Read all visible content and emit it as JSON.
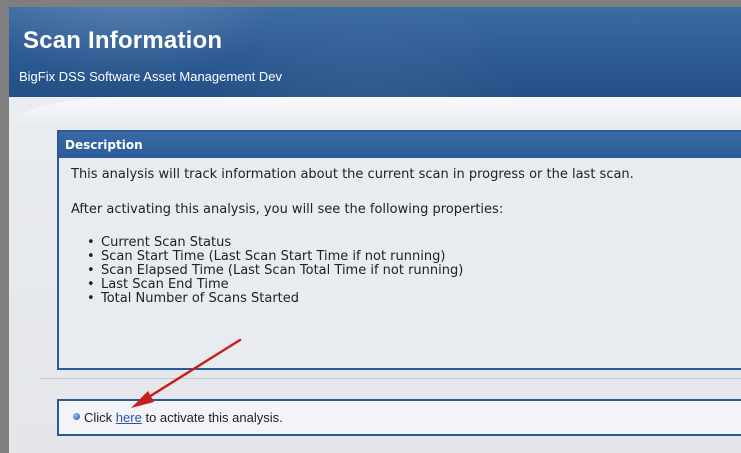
{
  "header": {
    "title": "Scan Information",
    "subtitle": "BigFix DSS Software Asset Management Dev"
  },
  "description": {
    "heading": "Description",
    "intro": "This analysis will track information about the current scan in progress or the last scan.",
    "after": "After activating this analysis, you will see the following properties:",
    "properties": [
      "Current Scan Status",
      "Scan Start Time (Last Scan Start Time if not running)",
      "Scan Elapsed Time (Last Scan Total Time if not running)",
      "Last Scan End Time",
      "Total Number of Scans Started"
    ]
  },
  "action": {
    "prefix": "Click",
    "link_label": "here",
    "suffix": "to activate this analysis."
  },
  "colors": {
    "header_blue": "#2c5a92",
    "panel_border": "#2b5a96",
    "annotation_arrow": "#c8201e",
    "link": "#2a55a7"
  },
  "icons": {
    "bullet": "blue-dot-icon",
    "annotation": "red-arrow-icon"
  }
}
